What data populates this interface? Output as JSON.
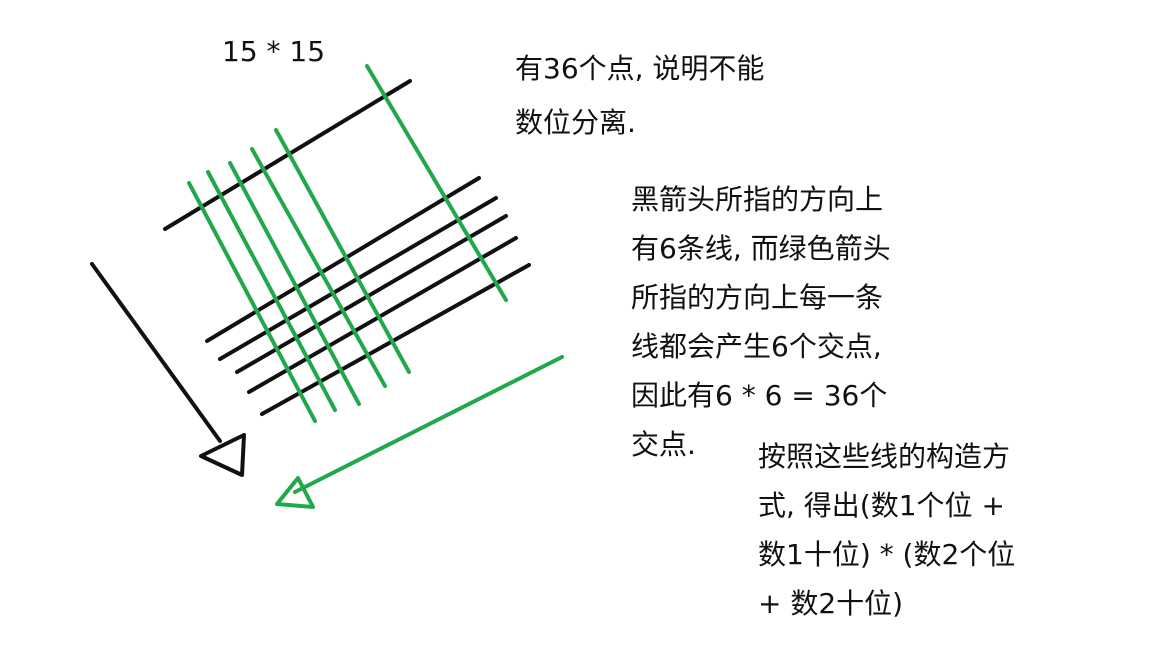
{
  "title_label": "15 * 15",
  "notes": {
    "top": [
      "有36个点, 说明不能",
      "数位分离."
    ],
    "middle": [
      "黑箭头所指的方向上",
      "有6条线, 而绿色箭头",
      "所指的方向上每一条",
      "线都会产生6个交点,",
      "因此有6 * 6 = 36个",
      "交点."
    ],
    "bottom": [
      "按照这些线的构造方",
      "式, 得出(数1个位 +",
      "数1十位) * (数2个位",
      "+ 数2十位)"
    ]
  },
  "colors": {
    "black_lines": "#111111",
    "green_lines": "#22a84a",
    "text": "#111111",
    "background": "#ffffff"
  },
  "counts": {
    "black_lines": 6,
    "green_lines": 6
  }
}
